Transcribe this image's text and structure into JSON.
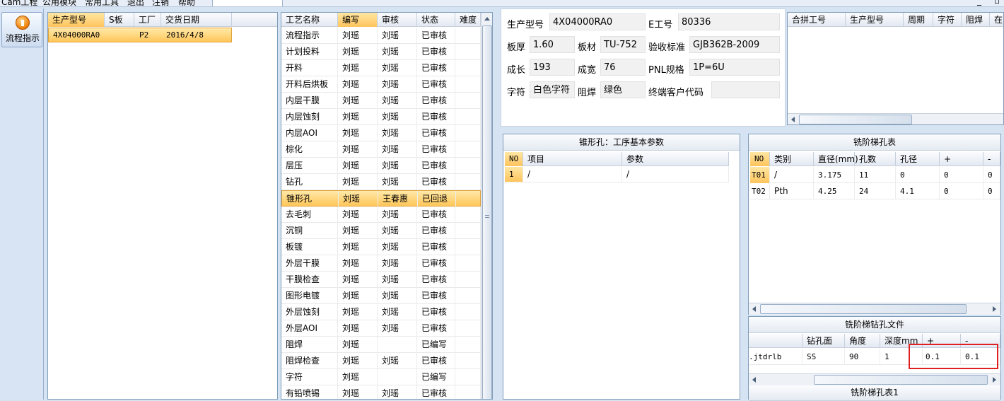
{
  "menu": {
    "items": [
      "Cam工程",
      "公用模块",
      "常用工具",
      "退出",
      "注销",
      "帮助"
    ]
  },
  "sidebar": {
    "flow_button": "流程指示",
    "flow_icon": "pause-icon"
  },
  "orders": {
    "headers": [
      "生产型号",
      "S板",
      "工厂",
      "交货日期"
    ],
    "rows": [
      {
        "model": "4X04000RA0",
        "s": "",
        "factory": "P2",
        "date": "2016/4/8"
      }
    ]
  },
  "process": {
    "headers": [
      "工艺名称",
      "编写",
      "审核",
      "状态",
      "难度"
    ],
    "rows": [
      {
        "name": "流程指示",
        "author": "刘瑶",
        "reviewer": "刘瑶",
        "status": "已审核"
      },
      {
        "name": "计划投料",
        "author": "刘瑶",
        "reviewer": "刘瑶",
        "status": "已审核"
      },
      {
        "name": "开料",
        "author": "刘瑶",
        "reviewer": "刘瑶",
        "status": "已审核"
      },
      {
        "name": "开料后烘板",
        "author": "刘瑶",
        "reviewer": "刘瑶",
        "status": "已审核"
      },
      {
        "name": "内层干膜",
        "author": "刘瑶",
        "reviewer": "刘瑶",
        "status": "已审核"
      },
      {
        "name": "内层蚀刻",
        "author": "刘瑶",
        "reviewer": "刘瑶",
        "status": "已审核"
      },
      {
        "name": "内层AOI",
        "author": "刘瑶",
        "reviewer": "刘瑶",
        "status": "已审核"
      },
      {
        "name": "棕化",
        "author": "刘瑶",
        "reviewer": "刘瑶",
        "status": "已审核"
      },
      {
        "name": "层压",
        "author": "刘瑶",
        "reviewer": "刘瑶",
        "status": "已审核"
      },
      {
        "name": "钻孔",
        "author": "刘瑶",
        "reviewer": "刘瑶",
        "status": "已审核"
      },
      {
        "name": "锥形孔",
        "author": "刘瑶",
        "reviewer": "王春惠",
        "status": "已回退"
      },
      {
        "name": "去毛刺",
        "author": "刘瑶",
        "reviewer": "刘瑶",
        "status": "已审核"
      },
      {
        "name": "沉铜",
        "author": "刘瑶",
        "reviewer": "刘瑶",
        "status": "已审核"
      },
      {
        "name": "板镀",
        "author": "刘瑶",
        "reviewer": "刘瑶",
        "status": "已审核"
      },
      {
        "name": "外层干膜",
        "author": "刘瑶",
        "reviewer": "刘瑶",
        "status": "已审核"
      },
      {
        "name": "干膜检查",
        "author": "刘瑶",
        "reviewer": "刘瑶",
        "status": "已审核"
      },
      {
        "name": "图形电镀",
        "author": "刘瑶",
        "reviewer": "刘瑶",
        "status": "已审核"
      },
      {
        "name": "外层蚀刻",
        "author": "刘瑶",
        "reviewer": "刘瑶",
        "status": "已审核"
      },
      {
        "name": "外层AOI",
        "author": "刘瑶",
        "reviewer": "刘瑶",
        "status": "已审核"
      },
      {
        "name": "阻焊",
        "author": "刘瑶",
        "reviewer": "",
        "status": "已编写"
      },
      {
        "name": "阻焊检查",
        "author": "刘瑶",
        "reviewer": "刘瑶",
        "status": "已审核"
      },
      {
        "name": "字符",
        "author": "刘瑶",
        "reviewer": "",
        "status": "已编写"
      },
      {
        "name": "有铅喷锡",
        "author": "刘瑶",
        "reviewer": "刘瑶",
        "status": "已审核"
      }
    ]
  },
  "info": {
    "model_label": "生产型号",
    "model": "4X04000RA0",
    "eno_label": "E工号",
    "eno": "80336",
    "thickness_label": "板厚",
    "thickness": "1.60",
    "material_label": "板材",
    "material": "TU-752",
    "standard_label": "验收标准",
    "standard": "GJB362B-2009",
    "length_label": "成长",
    "length": "193",
    "width_label": "成宽",
    "width": "76",
    "pnl_label": "PNL规格",
    "pnl": "1P=6U",
    "char_label": "字符",
    "char": "白色字符",
    "mask_label": "阻焊",
    "mask": "绿色",
    "customer_label": "终端客户代码",
    "customer": ""
  },
  "combined": {
    "headers": [
      "合拼工号",
      "生产型号",
      "周期",
      "字符",
      "阻焊",
      "在"
    ]
  },
  "countersink": {
    "title": "锥形孔：工序基本参数",
    "headers": [
      "NO",
      "项目",
      "参数"
    ],
    "rows": [
      {
        "no": "1",
        "item": "/",
        "param": "/"
      }
    ]
  },
  "step_hole": {
    "title": "铣阶梯孔表",
    "headers": [
      "NO",
      "类别",
      "直径(mm)",
      "孔数",
      "孔径",
      "+",
      "-"
    ],
    "rows": [
      {
        "no": "T01",
        "type": "/",
        "dia": "3.175",
        "count": "11",
        "hole": "0",
        "plus": "0",
        "minus": "0"
      },
      {
        "no": "T02",
        "type": "Pth",
        "dia": "4.25",
        "count": "24",
        "hole": "4.1",
        "plus": "0",
        "minus": "0"
      }
    ]
  },
  "drill_file": {
    "title": "铣阶梯钻孔文件",
    "headers": [
      "",
      "钻孔面",
      "角度",
      "深度mm",
      "+",
      "-"
    ],
    "rows": [
      {
        "file": ".jtdrlb",
        "face": "SS",
        "angle": "90",
        "depth": "1",
        "plus": "0.1",
        "minus": "0.1"
      }
    ]
  },
  "step_hole2": {
    "title": "铣阶梯孔表1"
  },
  "colors": {
    "selection": "#ffc65a",
    "highlight": "#e02020",
    "header": "#e3e9f2"
  }
}
